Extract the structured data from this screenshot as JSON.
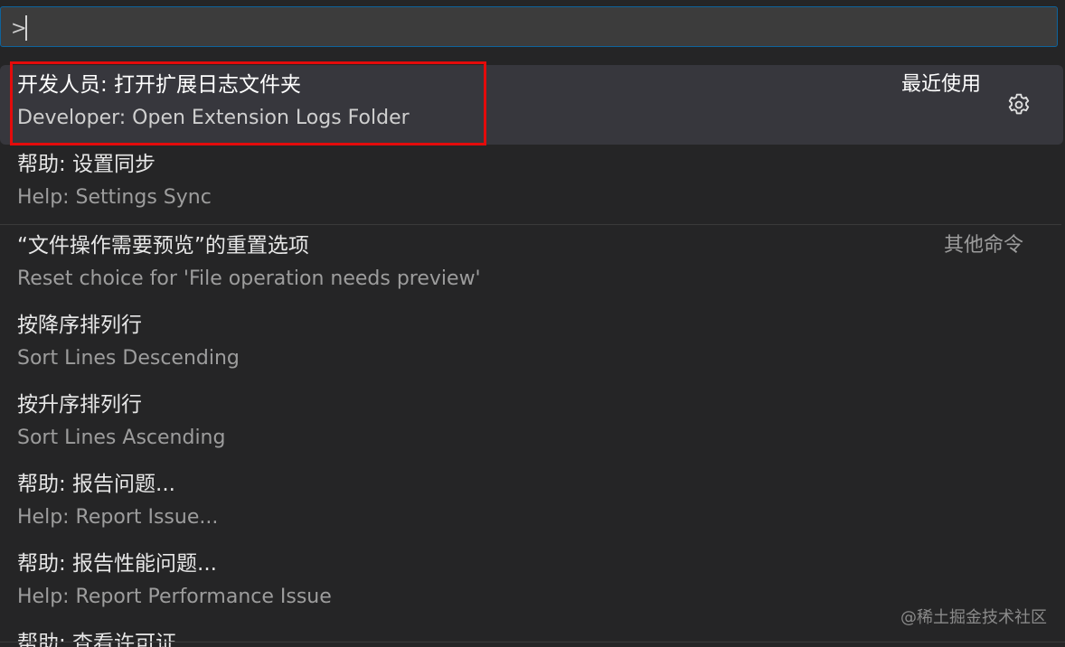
{
  "command_input": {
    "value": ">"
  },
  "commands": [
    {
      "label_cn": "开发人员: 打开扩展日志文件夹",
      "label_en": "Developer: Open Extension Logs Folder",
      "group": "最近使用",
      "selected": true
    },
    {
      "label_cn": "帮助: 设置同步",
      "label_en": "Help: Settings Sync"
    },
    {
      "label_cn": "“文件操作需要预览”的重置选项",
      "label_en": "Reset choice for 'File operation needs preview'",
      "group": "其他命令"
    },
    {
      "label_cn": "按降序排列行",
      "label_en": "Sort Lines Descending"
    },
    {
      "label_cn": "按升序排列行",
      "label_en": "Sort Lines Ascending"
    },
    {
      "label_cn": "帮助: 报告问题...",
      "label_en": "Help: Report Issue..."
    },
    {
      "label_cn": "帮助: 报告性能问题...",
      "label_en": "Help: Report Performance Issue"
    },
    {
      "label_cn": "帮助: 查看许可证"
    }
  ],
  "watermark": "@稀土掘金技术社区",
  "colors": {
    "background": "#252526",
    "input_border": "#0e639c",
    "selected_row": "#37373d",
    "annotation_box": "#e30b0b"
  }
}
